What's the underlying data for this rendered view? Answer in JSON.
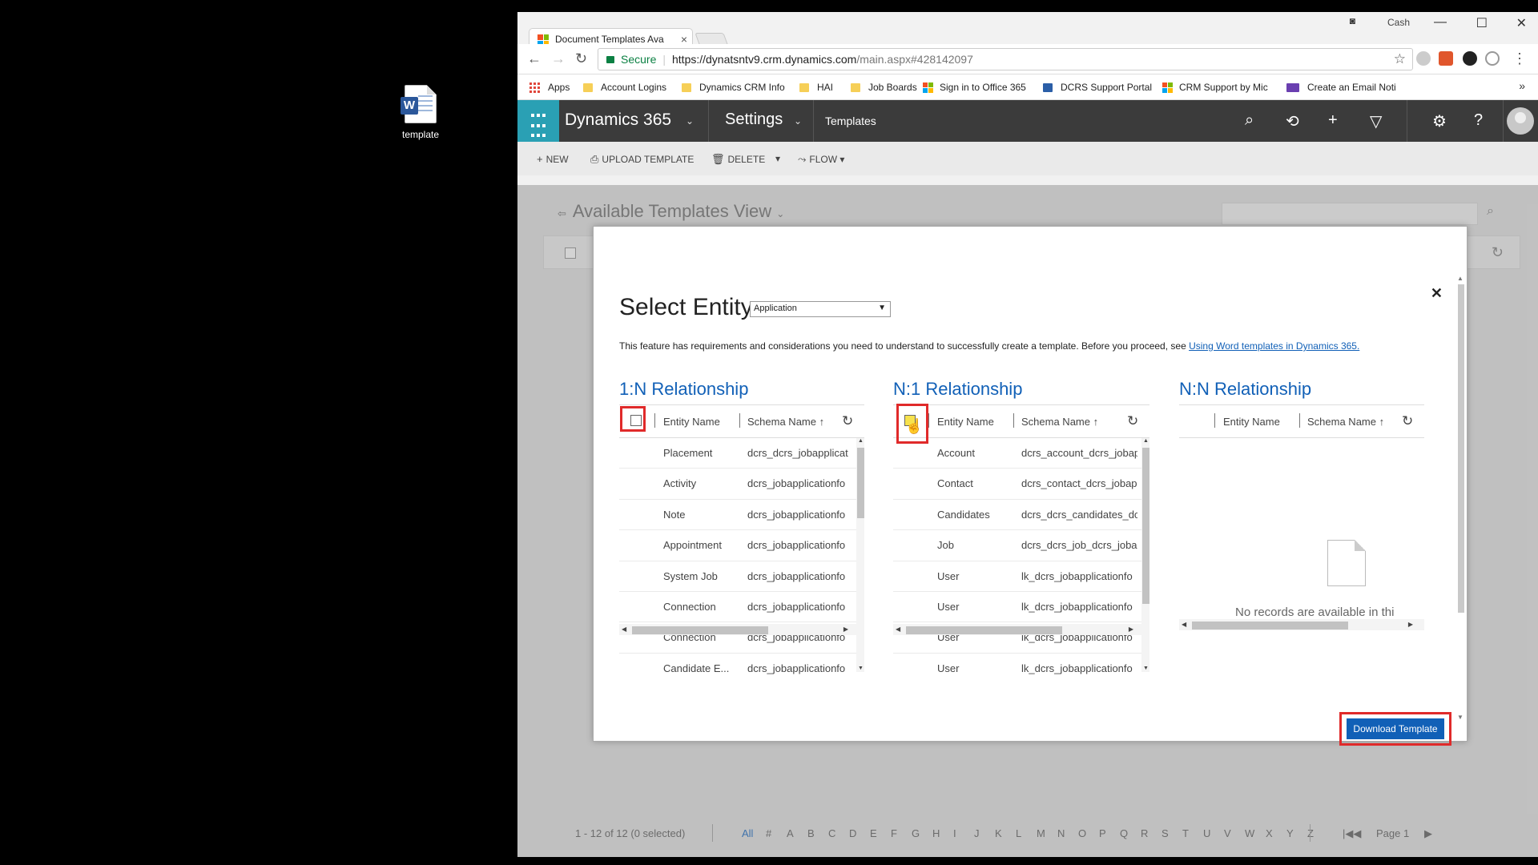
{
  "desktop": {
    "icon_label": "template"
  },
  "browser": {
    "tab_title": "Document Templates Ava",
    "tab_close": "×",
    "profile": "Cash",
    "url_secure": "Secure",
    "url_domain": "https://dynatsntv9.crm.dynamics.com",
    "url_path": "/main.aspx#428142097",
    "bookmarks": [
      "Apps",
      "Account Logins",
      "Dynamics CRM Info",
      "HAI",
      "Job Boards",
      "Sign in to Office 365",
      "DCRS Support Portal",
      "CRM Support by Mic",
      "Create an Email Noti"
    ],
    "bookmarks_more": "»"
  },
  "crm": {
    "app_title": "Dynamics 365",
    "area": "Settings",
    "subarea": "Templates",
    "commands": {
      "new": "NEW",
      "upload": "UPLOAD TEMPLATE",
      "delete": "DELETE",
      "flow": "FLOW"
    },
    "view_title": "Available Templates View",
    "pager": {
      "count": "1 - 12 of 12 (0 selected)",
      "letters": [
        "All",
        "#",
        "A",
        "B",
        "C",
        "D",
        "E",
        "F",
        "G",
        "H",
        "I",
        "J",
        "K",
        "L",
        "M",
        "N",
        "O",
        "P",
        "Q",
        "R",
        "S",
        "T",
        "U",
        "V",
        "W",
        "X",
        "Y",
        "Z"
      ],
      "page": "Page 1"
    }
  },
  "dialog": {
    "title": "Select Entity",
    "entity_value": "Application",
    "note": "This feature has requirements and considerations you need to understand to successfully create a template. Before you proceed, see ",
    "note_link": "Using Word templates in Dynamics 365.",
    "col_entity": "Entity Name",
    "col_schema": "Schema Name ↑",
    "one_to_many": {
      "title": "1:N Relationship",
      "rows": [
        [
          "Placement",
          "dcrs_dcrs_jobapplicat"
        ],
        [
          "Activity",
          "dcrs_jobapplicationfo"
        ],
        [
          "Note",
          "dcrs_jobapplicationfo"
        ],
        [
          "Appointment",
          "dcrs_jobapplicationfo"
        ],
        [
          "System Job",
          "dcrs_jobapplicationfo"
        ],
        [
          "Connection",
          "dcrs_jobapplicationfo"
        ],
        [
          "Connection",
          "dcrs_jobapplicationfo"
        ],
        [
          "Candidate E...",
          "dcrs_jobapplicationfo"
        ]
      ]
    },
    "many_to_one": {
      "title": "N:1 Relationship",
      "rows": [
        [
          "Account",
          "dcrs_account_dcrs_jobap"
        ],
        [
          "Contact",
          "dcrs_contact_dcrs_jobap"
        ],
        [
          "Candidates",
          "dcrs_dcrs_candidates_dc"
        ],
        [
          "Job",
          "dcrs_dcrs_job_dcrs_jobap"
        ],
        [
          "User",
          "lk_dcrs_jobapplicationfo"
        ],
        [
          "User",
          "lk_dcrs_jobapplicationfo"
        ],
        [
          "User",
          "lk_dcrs_jobapplicationfo"
        ],
        [
          "User",
          "lk_dcrs_jobapplicationfo"
        ]
      ]
    },
    "many_to_many": {
      "title": "N:N Relationship",
      "empty": "No records are available in thi"
    },
    "download_label": "Download Template"
  }
}
